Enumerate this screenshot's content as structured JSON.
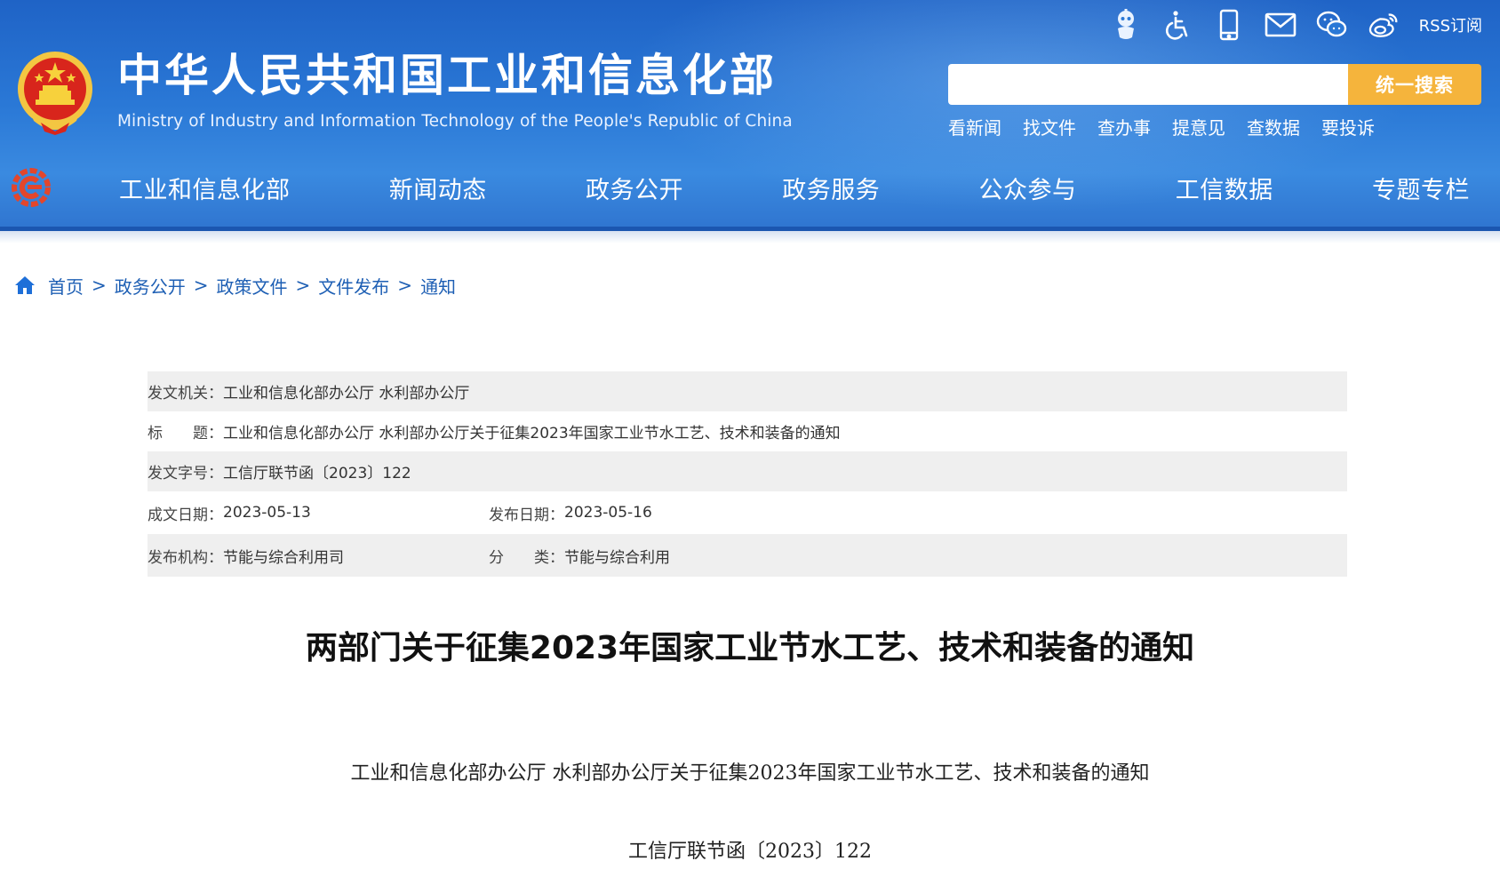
{
  "header": {
    "title": "中华人民共和国工业和信息化部",
    "subtitle": "Ministry of Industry and Information Technology of the People's Republic of China",
    "rss_label": "RSS订阅",
    "search": {
      "placeholder": "",
      "value": "",
      "button_label": "统一搜索"
    },
    "quick_links": [
      "看新闻",
      "找文件",
      "查办事",
      "提意见",
      "查数据",
      "要投诉"
    ],
    "nav": [
      "工业和信息化部",
      "新闻动态",
      "政务公开",
      "政务服务",
      "公众参与",
      "工信数据",
      "专题专栏"
    ],
    "icons": [
      "robot-icon",
      "accessibility-icon",
      "mobile-icon",
      "mail-icon",
      "wechat-icon",
      "weibo-icon"
    ]
  },
  "breadcrumb": [
    "首页",
    "政务公开",
    "政策文件",
    "文件发布",
    "通知"
  ],
  "meta": {
    "issuer_label": "发文机关：",
    "issuer": "工业和信息化部办公厅 水利部办公厅",
    "title_label": "标　　题：",
    "title": "工业和信息化部办公厅 水利部办公厅关于征集2023年国家工业节水工艺、技术和装备的通知",
    "doc_number_label": "发文字号：",
    "doc_number": "工信厅联节函〔2023〕122",
    "created_label": "成文日期：",
    "created": "2023-05-13",
    "published_label": "发布日期：",
    "published": "2023-05-16",
    "org_label": "发布机构：",
    "org": "节能与综合利用司",
    "category_label": "分　　类：",
    "category": "节能与综合利用"
  },
  "article": {
    "title": "两部门关于征集2023年国家工业节水工艺、技术和装备的通知",
    "subtitle": "工业和信息化部办公厅  水利部办公厅关于征集2023年国家工业节水工艺、技术和装备的通知",
    "doc_number": "工信厅联节函〔2023〕122"
  },
  "colors": {
    "header_blue": "#2a78d6",
    "search_button": "#f5b43c",
    "link_blue": "#1e5fb4",
    "meta_shade": "#efefef"
  }
}
